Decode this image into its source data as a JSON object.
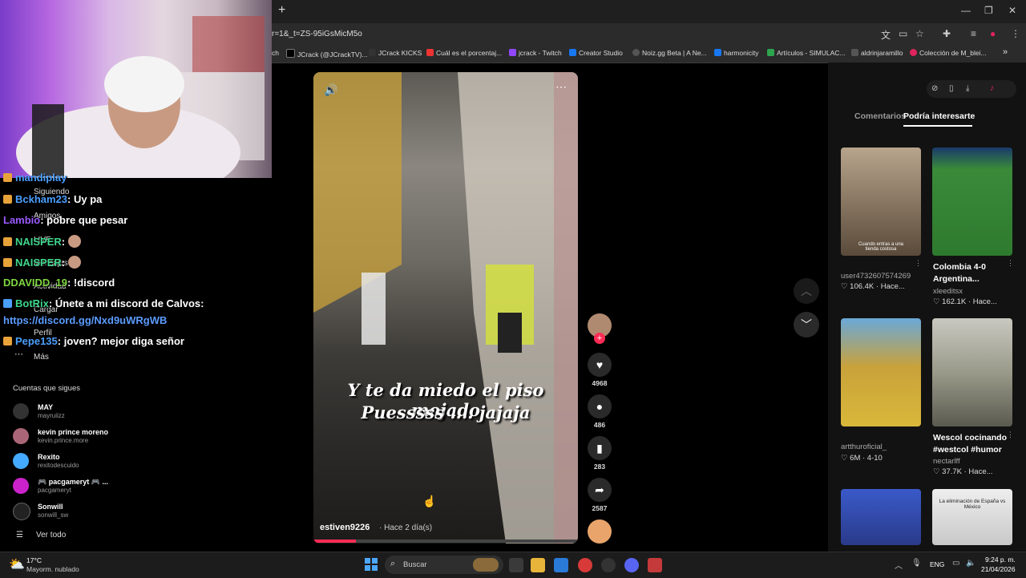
{
  "browser": {
    "url_fragment": "r=1&_t=ZS-95iGsMicM5o",
    "new_tab_symbol": "+",
    "bookmarks": [
      {
        "label": "ch",
        "color": "#444"
      },
      {
        "label": "JCrack (@JCrackTV)...",
        "color": "#000"
      },
      {
        "label": "JCrack KICKS",
        "color": "#333"
      },
      {
        "label": "Cuál es el porcentaj...",
        "color": "#e33"
      },
      {
        "label": "jcrack - Twitch",
        "color": "#9146ff"
      },
      {
        "label": "Creator Studio",
        "color": "#1877f2"
      },
      {
        "label": "Noiz.gg Beta | A Ne...",
        "color": "#555"
      },
      {
        "label": "harmonicity",
        "color": "#1877f2"
      },
      {
        "label": "Artículos - SIMULAC...",
        "color": "#2da44e"
      },
      {
        "label": "aldrinjaramillo",
        "color": "#555"
      },
      {
        "label": "Colección de M_blei...",
        "color": "#e0245e"
      }
    ],
    "bookmarks_overflow": "»"
  },
  "sidebar": {
    "nav": [
      {
        "label": "Siguiendo"
      },
      {
        "label": "Amigos"
      },
      {
        "label": "LIVE"
      },
      {
        "label": "Mensajes"
      },
      {
        "label": "Actividad"
      },
      {
        "label": "Cargar"
      },
      {
        "label": "Perfil"
      },
      {
        "label": "Más"
      }
    ],
    "following_header": "Cuentas que sigues",
    "following": [
      {
        "name": "MAY",
        "user": "mayruiizz",
        "color": "#333"
      },
      {
        "name": "kevin prince moreno",
        "user": "kevin.prince.more",
        "color": "#a67"
      },
      {
        "name": "Rexito",
        "user": "rexitodescuido",
        "color": "#4af"
      },
      {
        "name": "🎮 pacgameryt 🎮 ...",
        "user": "pacgameryt",
        "color": "#c2c"
      },
      {
        "name": "Sonwill",
        "user": "sonwill_sw",
        "color": "#222"
      }
    ],
    "see_all": "Ver todo"
  },
  "chat": [
    {
      "user": "mandiplay",
      "msg": "",
      "color": "#4a9fff"
    },
    {
      "user": "Bckham23",
      "msg": ": Uy pa",
      "color": "#4a9fff"
    },
    {
      "user": "Lambio",
      "msg": ": pobre que pesar",
      "color": "#9b59ff"
    },
    {
      "user": "NAISPER",
      "msg": ":",
      "color": "#3fd68a"
    },
    {
      "user": "NAISPER",
      "msg": ":",
      "color": "#3fd68a"
    },
    {
      "user": "DDAVIDD_19",
      "msg": ": !discord",
      "color": "#7fd63f"
    },
    {
      "user": "BotRix",
      "msg": ": Únete a mi discord de Calvos:",
      "color": "#3fd68a"
    },
    {
      "user": "",
      "msg": "https://discord.gg/Nxd9uWRgWB",
      "color": "#5b9cff"
    },
    {
      "user": "Pepe135",
      "msg": ": joven? mejor diga señor",
      "color": "#4a9fff"
    }
  ],
  "video": {
    "caption_line1": "Y te da miedo el piso mojado",
    "caption_line2": "Puesssss .... jajaja",
    "author": "estiven9226",
    "time_ago": "· Hace 2 día(s)",
    "progress": 0.16
  },
  "actions": [
    {
      "icon": "heart-icon",
      "count": "4968"
    },
    {
      "icon": "comment-icon",
      "count": "486"
    },
    {
      "icon": "bookmark-icon",
      "count": "283"
    },
    {
      "icon": "share-icon",
      "count": "2587"
    }
  ],
  "right_panel": {
    "tabs": [
      "Comentarios",
      "Podría interesarte"
    ],
    "active_tab": 1,
    "videos": [
      {
        "title": "",
        "user": "user4732607574269",
        "stats": "♡ 106.4K · Hace...",
        "overlay": "Cuando entras a una tienda costosa",
        "color": "#8a7a6a"
      },
      {
        "title": "Colombia 4-0 Argentina...",
        "user": "xleeditsx",
        "stats": "♡ 162.1K · Hace...",
        "overlay": "",
        "color": "#3a8a3a"
      },
      {
        "title": "",
        "user": "artthuroficial_",
        "stats": "♡ 6M · 4-10",
        "overlay": "",
        "color": "#c9a23a"
      },
      {
        "title": "Wescol cocinando #westcol #humor",
        "user": "nectarlff",
        "stats": "♡ 37.7K · Hace...",
        "overlay": "",
        "color": "#9a9a8a"
      },
      {
        "title": "",
        "user": "",
        "stats": "",
        "overlay": "",
        "color": "#3a5ac9"
      },
      {
        "title": "",
        "user": "",
        "stats": "",
        "overlay": "La eliminación de España vs México",
        "color": "#d8d8d8"
      }
    ]
  },
  "taskbar": {
    "weather_temp": "17°C",
    "weather_desc": "Mayorm. nublado",
    "search_placeholder": "Buscar",
    "lang": "ENG",
    "time": "9:24 p. m.",
    "date": "21/04/2026"
  }
}
